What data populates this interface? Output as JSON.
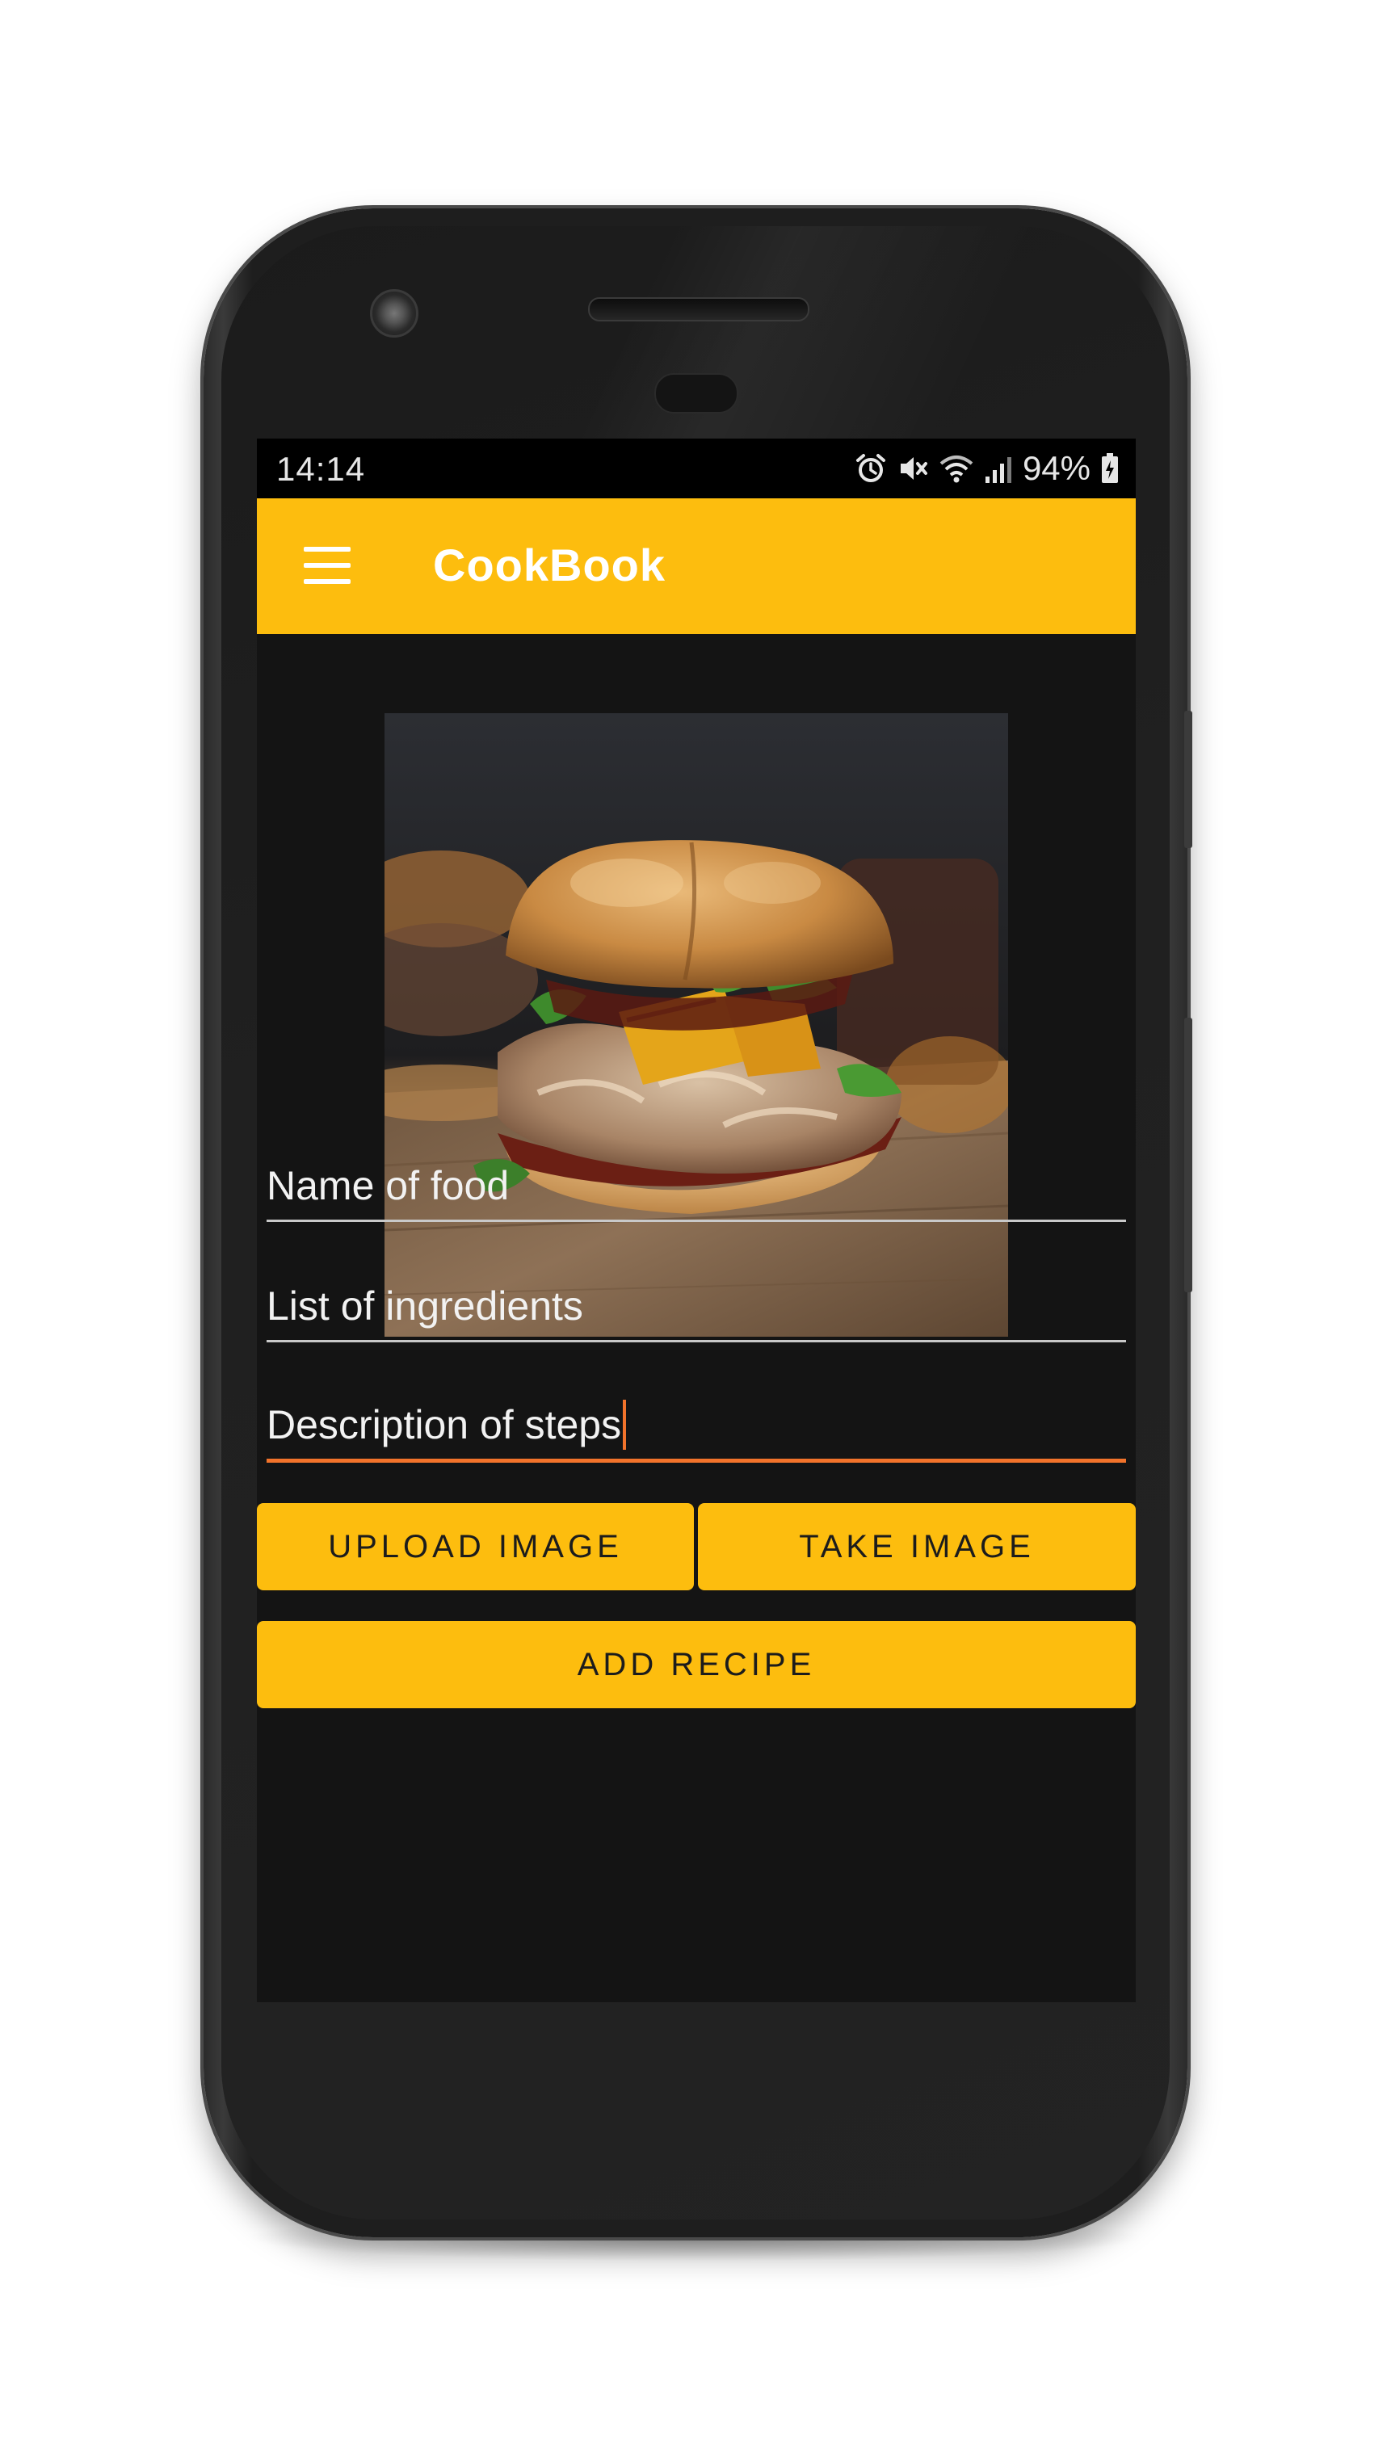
{
  "status_bar": {
    "time": "14:14",
    "battery_percent": "94%",
    "icons": [
      "alarm-icon",
      "mute-icon",
      "wifi-icon",
      "signal-icon",
      "battery-icon"
    ]
  },
  "app_bar": {
    "title": "CookBook",
    "menu_icon": "hamburger-menu-icon"
  },
  "hero_image": {
    "subject": "pulled pork sandwich"
  },
  "form": {
    "fields": [
      {
        "placeholder": "Name of food",
        "value": ""
      },
      {
        "placeholder": "List of ingredients",
        "value": ""
      },
      {
        "placeholder": "Description of steps",
        "value": "",
        "focused": true
      }
    ]
  },
  "buttons": {
    "upload_image": "UPLOAD IMAGE",
    "take_image": "TAKE IMAGE",
    "add_recipe": "ADD RECIPE"
  },
  "colors": {
    "accent": "#fdbd0e",
    "focus_underline": "#f2732b",
    "background": "#141414",
    "status_bar": "#000000"
  }
}
